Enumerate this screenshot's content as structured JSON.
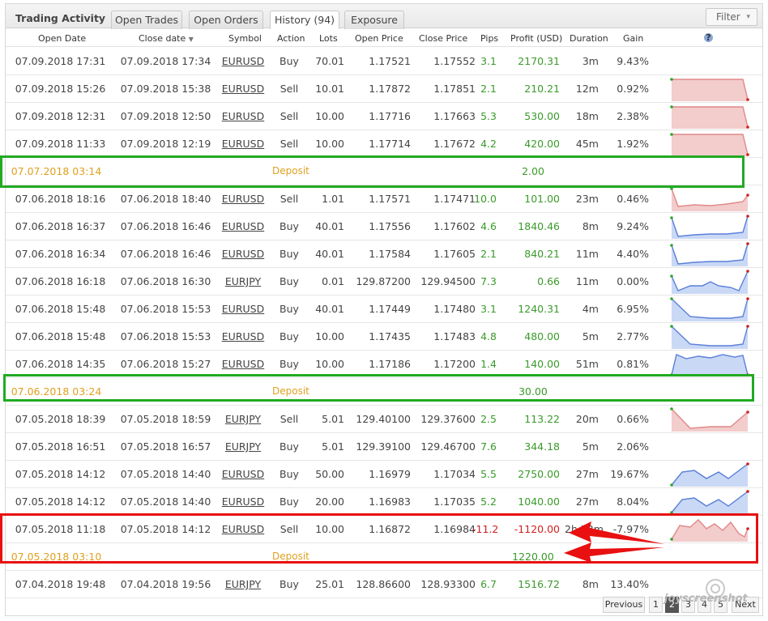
{
  "header": {
    "title": "Trading Activity",
    "tabs": [
      "Open Trades",
      "Open Orders",
      "History (94)",
      "Exposure"
    ],
    "filter_label": "Filter"
  },
  "columns": [
    "Open Date",
    "Close date",
    "Symbol",
    "Action",
    "Lots",
    "Open Price",
    "Close Price",
    "Pips",
    "Profit (USD)",
    "Duration",
    "Gain"
  ],
  "sort_indicator": "▼",
  "help_glyph": "?",
  "rows": [
    {
      "kind": "trade",
      "open": "07.09.2018 17:31",
      "close": "07.09.2018 17:34",
      "symbol": "EURUSD",
      "action": "Buy",
      "lots": "70.01",
      "open_price": "1.17521",
      "close_price": "1.17552",
      "pips": "3.1",
      "profit": "2170.31",
      "duration": "3m",
      "gain": "9.43%",
      "spark": "none"
    },
    {
      "kind": "trade",
      "open": "07.09.2018 15:26",
      "close": "07.09.2018 15:38",
      "symbol": "EURUSD",
      "action": "Sell",
      "lots": "10.01",
      "open_price": "1.17872",
      "close_price": "1.17851",
      "pips": "2.1",
      "profit": "210.21",
      "duration": "12m",
      "gain": "0.92%",
      "spark": "red-drop"
    },
    {
      "kind": "trade",
      "open": "07.09.2018 12:31",
      "close": "07.09.2018 12:50",
      "symbol": "EURUSD",
      "action": "Sell",
      "lots": "10.00",
      "open_price": "1.17716",
      "close_price": "1.17663",
      "pips": "5.3",
      "profit": "530.00",
      "duration": "18m",
      "gain": "2.38%",
      "spark": "red-drop"
    },
    {
      "kind": "trade",
      "open": "07.09.2018 11:33",
      "close": "07.09.2018 12:19",
      "symbol": "EURUSD",
      "action": "Sell",
      "lots": "10.00",
      "open_price": "1.17714",
      "close_price": "1.17672",
      "pips": "4.2",
      "profit": "420.00",
      "duration": "45m",
      "gain": "1.92%",
      "spark": "red-drop"
    },
    {
      "kind": "deposit",
      "open": "07.07.2018 03:14",
      "type": "Deposit",
      "amount": "2.00"
    },
    {
      "kind": "trade",
      "open": "07.06.2018 18:16",
      "close": "07.06.2018 18:40",
      "symbol": "EURUSD",
      "action": "Sell",
      "lots": "1.01",
      "open_price": "1.17571",
      "close_price": "1.17471",
      "pips": "10.0",
      "profit": "101.00",
      "duration": "23m",
      "gain": "0.46%",
      "spark": "red-low"
    },
    {
      "kind": "trade",
      "open": "07.06.2018 16:37",
      "close": "07.06.2018 16:46",
      "symbol": "EURUSD",
      "action": "Buy",
      "lots": "40.01",
      "open_price": "1.17556",
      "close_price": "1.17602",
      "pips": "4.6",
      "profit": "1840.46",
      "duration": "8m",
      "gain": "9.24%",
      "spark": "blue-rise"
    },
    {
      "kind": "trade",
      "open": "07.06.2018 16:34",
      "close": "07.06.2018 16:46",
      "symbol": "EURUSD",
      "action": "Buy",
      "lots": "40.01",
      "open_price": "1.17584",
      "close_price": "1.17605",
      "pips": "2.1",
      "profit": "840.21",
      "duration": "11m",
      "gain": "4.40%",
      "spark": "blue-rise"
    },
    {
      "kind": "trade",
      "open": "07.06.2018 16:18",
      "close": "07.06.2018 16:30",
      "symbol": "EURJPY",
      "action": "Buy",
      "lots": "0.01",
      "open_price": "129.87200",
      "close_price": "129.94500",
      "pips": "7.3",
      "profit": "0.66",
      "duration": "11m",
      "gain": "0.00%",
      "spark": "blue-wave"
    },
    {
      "kind": "trade",
      "open": "07.06.2018 15:48",
      "close": "07.06.2018 15:53",
      "symbol": "EURUSD",
      "action": "Buy",
      "lots": "40.01",
      "open_price": "1.17449",
      "close_price": "1.17480",
      "pips": "3.1",
      "profit": "1240.31",
      "duration": "4m",
      "gain": "6.95%",
      "spark": "blue-v"
    },
    {
      "kind": "trade",
      "open": "07.06.2018 15:48",
      "close": "07.06.2018 15:53",
      "symbol": "EURUSD",
      "action": "Buy",
      "lots": "10.00",
      "open_price": "1.17435",
      "close_price": "1.17483",
      "pips": "4.8",
      "profit": "480.00",
      "duration": "5m",
      "gain": "2.77%",
      "spark": "blue-v"
    },
    {
      "kind": "trade",
      "open": "07.06.2018 14:35",
      "close": "07.06.2018 15:27",
      "symbol": "EURUSD",
      "action": "Buy",
      "lots": "10.00",
      "open_price": "1.17186",
      "close_price": "1.17200",
      "pips": "1.4",
      "profit": "140.00",
      "duration": "51m",
      "gain": "0.81%",
      "spark": "blue-plateau"
    },
    {
      "kind": "deposit",
      "open": "07.06.2018 03:24",
      "type": "Deposit",
      "amount": "30.00"
    },
    {
      "kind": "trade",
      "open": "07.05.2018 18:39",
      "close": "07.05.2018 18:59",
      "symbol": "EURJPY",
      "action": "Sell",
      "lots": "5.01",
      "open_price": "129.40100",
      "close_price": "129.37600",
      "pips": "2.5",
      "profit": "113.22",
      "duration": "20m",
      "gain": "0.66%",
      "spark": "red-dip"
    },
    {
      "kind": "trade",
      "open": "07.05.2018 16:51",
      "close": "07.05.2018 16:57",
      "symbol": "EURJPY",
      "action": "Buy",
      "lots": "5.01",
      "open_price": "129.39100",
      "close_price": "129.46700",
      "pips": "7.6",
      "profit": "344.18",
      "duration": "5m",
      "gain": "2.06%",
      "spark": "none"
    },
    {
      "kind": "trade",
      "open": "07.05.2018 14:12",
      "close": "07.05.2018 14:40",
      "symbol": "EURUSD",
      "action": "Buy",
      "lots": "50.00",
      "open_price": "1.16979",
      "close_price": "1.17034",
      "pips": "5.5",
      "profit": "2750.00",
      "duration": "27m",
      "gain": "19.67%",
      "spark": "blue-hump"
    },
    {
      "kind": "trade",
      "open": "07.05.2018 14:12",
      "close": "07.05.2018 14:40",
      "symbol": "EURUSD",
      "action": "Buy",
      "lots": "20.00",
      "open_price": "1.16983",
      "close_price": "1.17035",
      "pips": "5.2",
      "profit": "1040.00",
      "duration": "27m",
      "gain": "8.04%",
      "spark": "blue-hump"
    },
    {
      "kind": "trade",
      "open": "07.05.2018 11:18",
      "close": "07.05.2018 14:12",
      "symbol": "EURUSD",
      "action": "Sell",
      "lots": "10.00",
      "open_price": "1.16872",
      "close_price": "1.16984",
      "pips": "-11.2",
      "profit": "-1120.00",
      "duration": "2h 53m",
      "gain": "-7.97%",
      "spark": "red-choppy"
    },
    {
      "kind": "deposit",
      "open": "07.05.2018 03:10",
      "type": "Deposit",
      "amount": "1220.00"
    },
    {
      "kind": "trade",
      "open": "07.04.2018 19:48",
      "close": "07.04.2018 19:56",
      "symbol": "EURJPY",
      "action": "Buy",
      "lots": "25.01",
      "open_price": "128.86600",
      "close_price": "128.93300",
      "pips": "6.7",
      "profit": "1516.72",
      "duration": "8m",
      "gain": "13.40%",
      "spark": "none"
    }
  ],
  "pagination": {
    "previous": "Previous",
    "pages": [
      "1",
      "2",
      "3",
      "4",
      "5"
    ],
    "current": "2",
    "next": "Next"
  },
  "watermark": "joyscreenshot",
  "colors": {
    "positive": "#3a9a2a",
    "negative": "#d02020",
    "deposit": "#e0a020",
    "green_highlight": "#22aa22",
    "red_highlight": "#e81010"
  }
}
